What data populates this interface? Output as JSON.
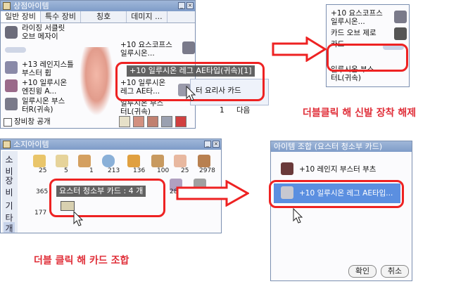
{
  "shop": {
    "title": "상점아이템",
    "tabs": [
      "일반 장비",
      "특수 장비",
      "칭호",
      "데미지 ..."
    ],
    "left_items": [
      "라이징 서클릿\n오브 메자이",
      "+13 레인지스틀\n부스터 휩",
      "+10 일루시온\n엔진윙 A...",
      "일루시온 부스\n터R(귀속)"
    ],
    "right_items": [
      "+10 요스코프스\n일루시온...",
      "+10 일루시온\n레그 AE타...",
      "일루시온 부스\n터L(귀속)"
    ],
    "tooltip": "+10 일루시온 레그 AE타입(귀속)[1]",
    "card_label": "터 요리사 카드",
    "page_num": "1",
    "next_label": "다음",
    "checkbox_label": "장비창 공개"
  },
  "small_panel": {
    "items": [
      "+10 요스코프스\n일루시온...",
      "카드 오브 제로",
      "카드",
      "일루시온 부스\n터L(귀속)"
    ]
  },
  "inventory": {
    "title": "소지아이템",
    "vtabs": [
      "소비",
      "장비",
      "기타",
      "개"
    ],
    "counts_row1": [
      "25",
      "5",
      "1",
      "213",
      "136",
      "100",
      "25",
      "2978"
    ],
    "counts_row2": [
      "365",
      "",
      "",
      "",
      "",
      "",
      "2883",
      "2617"
    ],
    "counts_row3": [
      "177"
    ],
    "tooltip": "요스터 청소부 카드 : 4 개"
  },
  "combine": {
    "title": "아이템 조합 (요스터 청소부 카드)",
    "items": [
      "+10 레인지 부스터 부츠",
      "+10 일루시온 레그 AE타입..."
    ],
    "ok": "확인",
    "cancel": "취소"
  },
  "annotations": {
    "unequip": "더블클릭 해 신발 장착 해제",
    "combine": "더블 클릭 해 카드 조합"
  },
  "colors": {
    "accent_red": "#e0303a",
    "selection": "#5b8fe0"
  }
}
